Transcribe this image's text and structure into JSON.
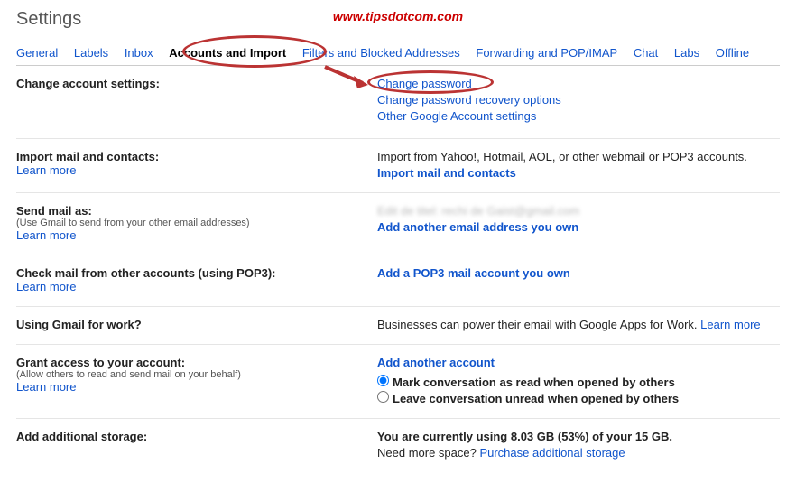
{
  "watermark": "www.tipsdotcom.com",
  "pageTitle": "Settings",
  "tabs": [
    "General",
    "Labels",
    "Inbox",
    "Accounts and Import",
    "Filters and Blocked Addresses",
    "Forwarding and POP/IMAP",
    "Chat",
    "Labs",
    "Offline"
  ],
  "s1": {
    "title": "Change account settings:",
    "l1": "Change password",
    "l2": "Change password recovery options",
    "l3": "Other Google Account settings"
  },
  "s2": {
    "title": "Import mail and contacts:",
    "learn": "Learn more",
    "text": "Import from Yahoo!, Hotmail, AOL, or other webmail or POP3 accounts.",
    "link": "Import mail and contacts"
  },
  "s3": {
    "title": "Send mail as:",
    "sub": "(Use Gmail to send from your other email addresses)",
    "learn": "Learn more",
    "blur": "Edit de titel: rechi de Gaist@gmail.com",
    "link": "Add another email address you own"
  },
  "s4": {
    "title": "Check mail from other accounts (using POP3):",
    "learn": "Learn more",
    "link": "Add a POP3 mail account you own"
  },
  "s5": {
    "title": "Using Gmail for work?",
    "text": "Businesses can power their email with Google Apps for Work. ",
    "learn": "Learn more"
  },
  "s6": {
    "title": "Grant access to your account:",
    "sub": "(Allow others to read and send mail on your behalf)",
    "learn": "Learn more",
    "link": "Add another account",
    "r1": "Mark conversation as read when opened by others",
    "r2": "Leave conversation unread when opened by others"
  },
  "s7": {
    "title": "Add additional storage:",
    "text": "You are currently using 8.03 GB (53%) of your 15 GB.",
    "need": "Need more space? ",
    "link": "Purchase additional storage"
  }
}
